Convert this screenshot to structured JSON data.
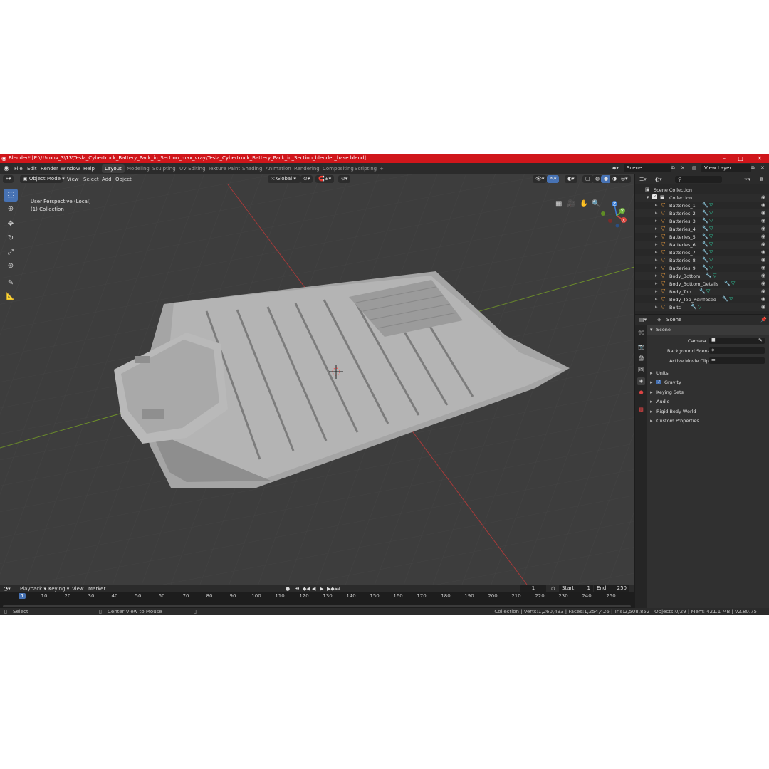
{
  "window": {
    "title": "Blender* [E:\\!!!conv_3\\13\\Tesla_Cybertruck_Battery_Pack_in_Section_max_vray\\Tesla_Cybertruck_Battery_Pack_in_Section_blender_base.blend]",
    "accent_color": "#d0161b"
  },
  "menu": {
    "items": [
      "File",
      "Edit",
      "Render",
      "Window",
      "Help"
    ],
    "workspaces": [
      "Layout",
      "Modeling",
      "Sculpting",
      "UV Editing",
      "Texture Paint",
      "Shading",
      "Animation",
      "Rendering",
      "Compositing",
      "Scripting"
    ],
    "active_workspace": "Layout",
    "add_tab": "+",
    "scene": "Scene",
    "view_layer": "View Layer"
  },
  "viewport": {
    "mode": "Object Mode",
    "menus": [
      "View",
      "Select",
      "Add",
      "Object"
    ],
    "transform_orientation": "Global",
    "view_name": "User Perspective (Local)",
    "collection_label": "(1) Collection",
    "gizmo_axes": [
      "X",
      "Y",
      "Z"
    ],
    "tools": [
      "select-box-icon",
      "cursor-icon",
      "move-icon",
      "rotate-icon",
      "scale-icon",
      "transform-icon",
      "annotate-icon",
      "measure-icon"
    ]
  },
  "timeline": {
    "menus": [
      "Playback",
      "Keying",
      "View",
      "Marker"
    ],
    "current_frame": "1",
    "start_label": "Start:",
    "start": "1",
    "end_label": "End:",
    "end": "250",
    "ruler": [
      "1",
      "10",
      "20",
      "30",
      "40",
      "50",
      "60",
      "70",
      "80",
      "90",
      "100",
      "110",
      "120",
      "130",
      "140",
      "150",
      "160",
      "170",
      "180",
      "190",
      "200",
      "210",
      "220",
      "230",
      "240",
      "250"
    ]
  },
  "statusbar": {
    "select": "Select",
    "center_view": "Center View to Mouse",
    "stats": "Collection | Verts:1,260,493 | Faces:1,254,426 | Tris:2,508,852 | Objects:0/29 | Mem: 421.1 MB | v2.80.75"
  },
  "outliner": {
    "root": "Scene Collection",
    "collection": "Collection",
    "objects": [
      {
        "name": "Batteries_1"
      },
      {
        "name": "Batteries_2"
      },
      {
        "name": "Batteries_3"
      },
      {
        "name": "Batteries_4"
      },
      {
        "name": "Batteries_5"
      },
      {
        "name": "Batteries_6"
      },
      {
        "name": "Batteries_7"
      },
      {
        "name": "Batteries_8"
      },
      {
        "name": "Batteries_9"
      },
      {
        "name": "Body_Bottom"
      },
      {
        "name": "Body_Bottom_Details"
      },
      {
        "name": "Body_Top"
      },
      {
        "name": "Body_Top_Reinfoced"
      },
      {
        "name": "Bolts"
      }
    ]
  },
  "properties": {
    "context": "Scene",
    "panel": "Scene",
    "camera_label": "Camera",
    "background_scene_label": "Background Scene",
    "active_movie_clip_label": "Active Movie Clip",
    "sections": [
      "Units",
      "Gravity",
      "Keying Sets",
      "Audio",
      "Rigid Body World",
      "Custom Properties"
    ],
    "gravity_checked": true
  }
}
